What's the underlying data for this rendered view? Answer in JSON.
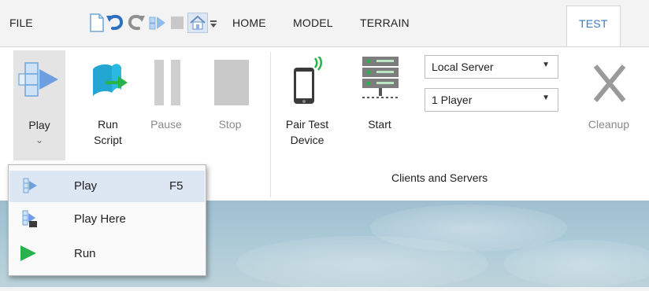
{
  "menu": {
    "file": "FILE"
  },
  "quick_access": {
    "icons": [
      "new-file-icon",
      "undo-icon",
      "redo-icon",
      "play-small-icon",
      "stop-small-icon",
      "home-icon",
      "customize-icon"
    ]
  },
  "tabs": [
    {
      "label": "HOME",
      "active": false
    },
    {
      "label": "MODEL",
      "active": false
    },
    {
      "label": "TERRAIN",
      "active": false
    },
    {
      "label": "TEST",
      "active": true
    }
  ],
  "ribbon": {
    "play": {
      "label": "Play",
      "arrow": "⌄"
    },
    "run_script": {
      "line1": "Run",
      "line2": "Script"
    },
    "pause": {
      "label": "Pause"
    },
    "stop": {
      "label": "Stop"
    },
    "pair_test_device": {
      "line1": "Pair Test",
      "line2": "Device"
    },
    "start": {
      "label": "Start"
    },
    "server_select": {
      "value": "Local Server"
    },
    "player_select": {
      "value": "1 Player"
    },
    "cleanup": {
      "label": "Cleanup"
    },
    "clients_group_label": "Clients and Servers"
  },
  "play_dropdown": {
    "items": [
      {
        "label": "Play",
        "shortcut": "F5",
        "icon": "play-icon",
        "highlighted": true
      },
      {
        "label": "Play Here",
        "shortcut": "",
        "icon": "play-here-icon",
        "highlighted": false
      },
      {
        "label": "Run",
        "shortcut": "",
        "icon": "run-icon",
        "highlighted": false
      }
    ]
  },
  "colors": {
    "active_tab_text": "#3a78c6",
    "accent_blue": "#5b8fd6",
    "run_green": "#27b24a",
    "teal": "#1fa8c9",
    "disabled_gray": "#c9c9c9"
  }
}
